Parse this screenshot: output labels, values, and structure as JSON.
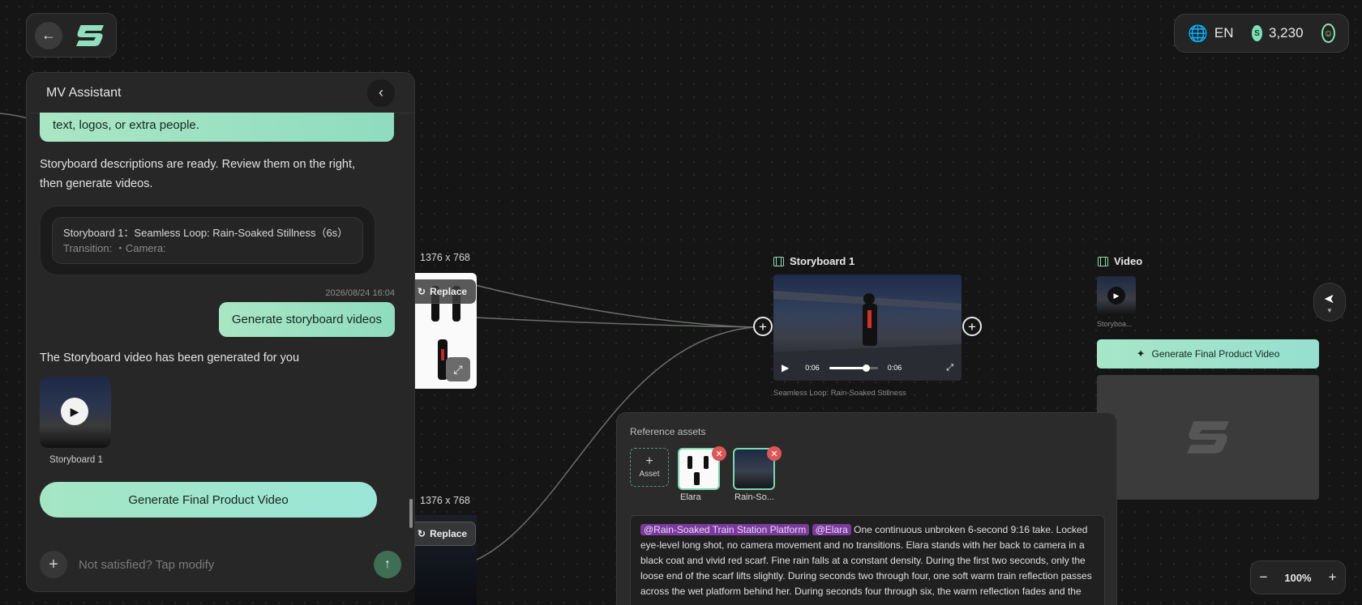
{
  "header": {
    "lang": "EN",
    "credits": "3,230",
    "colors": {
      "accent": "#8fdcc0",
      "bg": "#141514"
    }
  },
  "assistant": {
    "title": "MV Assistant",
    "prev_bubble_tail": "text, logos, or extra people.",
    "msg_ready": "Storyboard descriptions are ready. Review them on the right, then generate videos.",
    "storyboard_card": {
      "title": "Storyboard 1：Seamless Loop: Rain-Soaked Stillness（6s）",
      "meta": "Transition: ・Camera:"
    },
    "timestamp": "2026/08/24 16:04",
    "user_msg": "Generate storyboard videos",
    "msg_generated": "The Storyboard video has been generated for you",
    "thumb_label": "Storyboard 1",
    "final_button": "Generate Final Product Video",
    "input_placeholder": "Not satisfied? Tap modify"
  },
  "canvas": {
    "image_node_1": {
      "size": "1376 x 768",
      "replace": "Replace"
    },
    "image_node_2": {
      "size": "1376 x 768",
      "replace": "Replace"
    },
    "storyboard_node": {
      "title": "Storyboard 1",
      "time_current": "0:06",
      "time_total": "0:06",
      "progress": 0.75,
      "caption": "Seamless Loop: Rain-Soaked Stillness"
    },
    "video_node": {
      "title": "Video",
      "thumb_caption": "Storyboa...",
      "button": "Generate Final Product Video"
    },
    "reference": {
      "title": "Reference assets",
      "add_label": "Asset",
      "assets": [
        {
          "name": "Elara"
        },
        {
          "name": "Rain-So..."
        }
      ],
      "prompt_tags": [
        "@Rain-Soaked Train Station Platform",
        "@Elara"
      ],
      "prompt_text": "One continuous unbroken 6-second 9:16 take. Locked eye-level long shot, no camera movement and no transitions. Elara stands with her back to camera in a black coat and vivid red scarf. Fine rain falls at a constant density. During the first two seconds, only the loose end of the scarf lifts slightly. During seconds two through four, one soft warm train reflection passes across the wet platform behind her. During seconds four through six, the warm reflection fades and the"
    },
    "zoom": "100%"
  }
}
